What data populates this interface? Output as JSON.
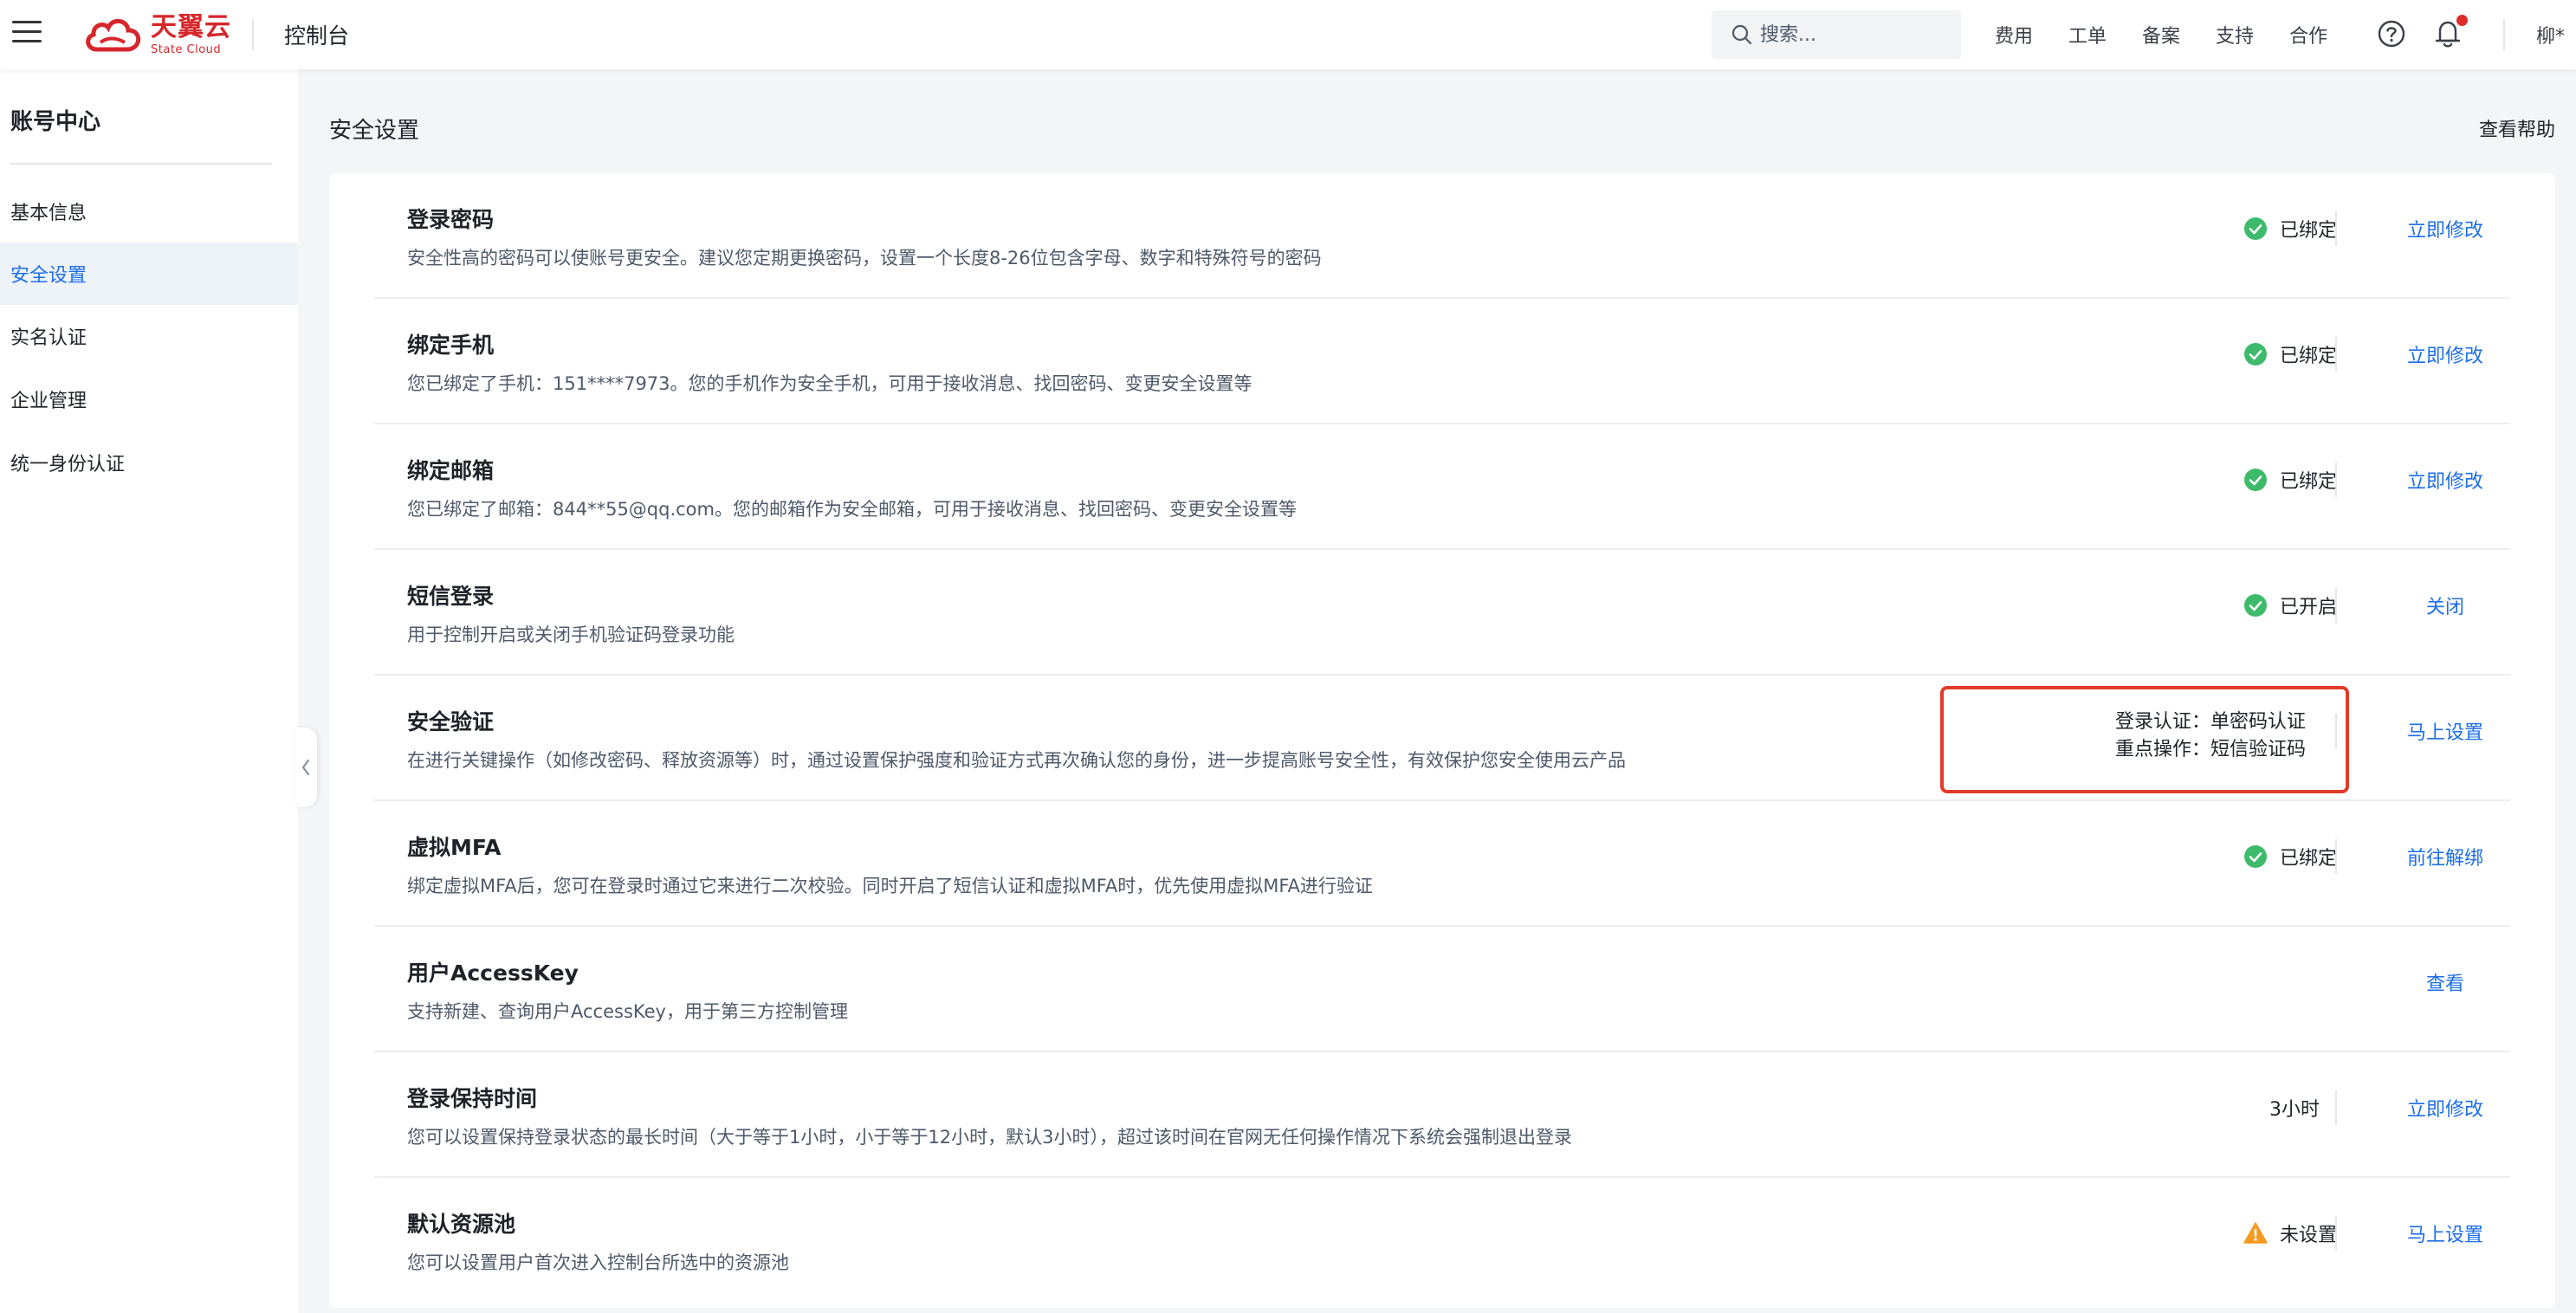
{
  "header": {
    "logo_cn": "天翼云",
    "logo_en": "State Cloud",
    "console_title": "控制台",
    "search_placeholder": "搜索...",
    "nav": [
      "费用",
      "工单",
      "备案",
      "支持",
      "合作"
    ],
    "user_name": "柳*"
  },
  "sidebar": {
    "title": "账号中心",
    "items": [
      {
        "label": "基本信息",
        "active": false
      },
      {
        "label": "安全设置",
        "active": true
      },
      {
        "label": "实名认证",
        "active": false
      },
      {
        "label": "企业管理",
        "active": false
      },
      {
        "label": "统一身份认证",
        "active": false
      }
    ]
  },
  "main": {
    "page_title": "安全设置",
    "help_link": "查看帮助",
    "rows": [
      {
        "title": "登录密码",
        "desc": "安全性高的密码可以使账号更安全。建议您定期更换密码，设置一个长度8-26位包含字母、数字和特殊符号的密码",
        "status": "已绑定",
        "status_icon": "check-circle-icon",
        "action": "立即修改"
      },
      {
        "title": "绑定手机",
        "desc": "您已绑定了手机：151****7973。您的手机作为安全手机，可用于接收消息、找回密码、变更安全设置等",
        "status": "已绑定",
        "status_icon": "check-circle-icon",
        "action": "立即修改"
      },
      {
        "title": "绑定邮箱",
        "desc": "您已绑定了邮箱：844**55@qq.com。您的邮箱作为安全邮箱，可用于接收消息、找回密码、变更安全设置等",
        "status": "已绑定",
        "status_icon": "check-circle-icon",
        "action": "立即修改"
      },
      {
        "title": "短信登录",
        "desc": "用于控制开启或关闭手机验证码登录功能",
        "status": "已开启",
        "status_icon": "check-circle-icon",
        "action": "关闭"
      },
      {
        "title": "安全验证",
        "desc": "在进行关键操作（如修改密码、释放资源等）时，通过设置保护强度和验证方式再次确认您的身份，进一步提高账号安全性，有效保护您安全使用云产品",
        "status_lines": [
          "登录认证：单密码认证",
          "重点操作：短信验证码"
        ],
        "action": "马上设置"
      },
      {
        "title": "虚拟MFA",
        "desc": "绑定虚拟MFA后，您可在登录时通过它来进行二次校验。同时开启了短信认证和虚拟MFA时，优先使用虚拟MFA进行验证",
        "status": "已绑定",
        "status_icon": "check-circle-icon",
        "action": "前往解绑"
      },
      {
        "title": "用户AccessKey",
        "desc": "支持新建、查询用户AccessKey，用于第三方控制管理",
        "action": "查看"
      },
      {
        "title": "登录保持时间",
        "desc": "您可以设置保持登录状态的最长时间（大于等于1小时，小于等于12小时，默认3小时），超过该时间在官网无任何操作情况下系统会强制退出登录",
        "status": "3小时",
        "action": "立即修改"
      },
      {
        "title": "默认资源池",
        "desc": "您可以设置用户首次进入控制台所选中的资源池",
        "status": "未设置",
        "status_icon": "warning-icon",
        "action": "马上设置"
      }
    ]
  },
  "colors": {
    "accent": "#1d6ee6",
    "success": "#3dbb6b",
    "warning": "#f59a23",
    "brand": "#d6262b",
    "highlight": "#e23b2a"
  }
}
